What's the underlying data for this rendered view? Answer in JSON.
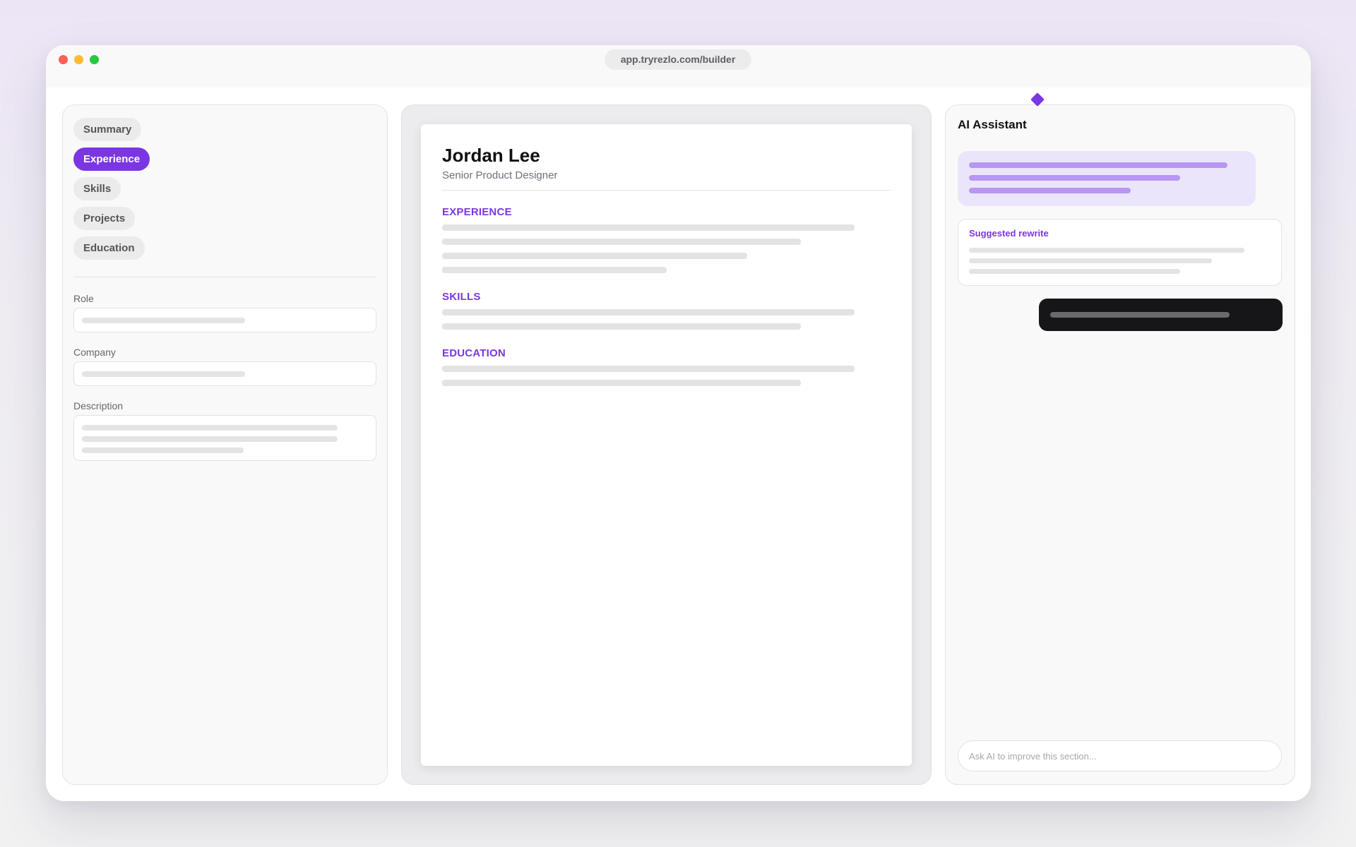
{
  "browser": {
    "url": "app.tryrezlo.com/builder"
  },
  "sidebar": {
    "sections": [
      {
        "label": "Summary",
        "active": false
      },
      {
        "label": "Experience",
        "active": true
      },
      {
        "label": "Skills",
        "active": false
      },
      {
        "label": "Projects",
        "active": false
      },
      {
        "label": "Education",
        "active": false
      }
    ],
    "fields": {
      "role_label": "Role",
      "company_label": "Company",
      "description_label": "Description"
    }
  },
  "resume": {
    "name": "Jordan Lee",
    "title": "Senior Product Designer",
    "sections": {
      "experience": "EXPERIENCE",
      "skills": "SKILLS",
      "education": "EDUCATION"
    }
  },
  "assistant": {
    "title": "AI Assistant",
    "icon": "sparkle-icon",
    "suggestion_label": "Suggested rewrite",
    "input_placeholder": "Ask AI to improve this section..."
  },
  "colors": {
    "accent": "#7b36e3",
    "ai_bubble": "#ebe5fc",
    "user_bubble": "#161618"
  }
}
